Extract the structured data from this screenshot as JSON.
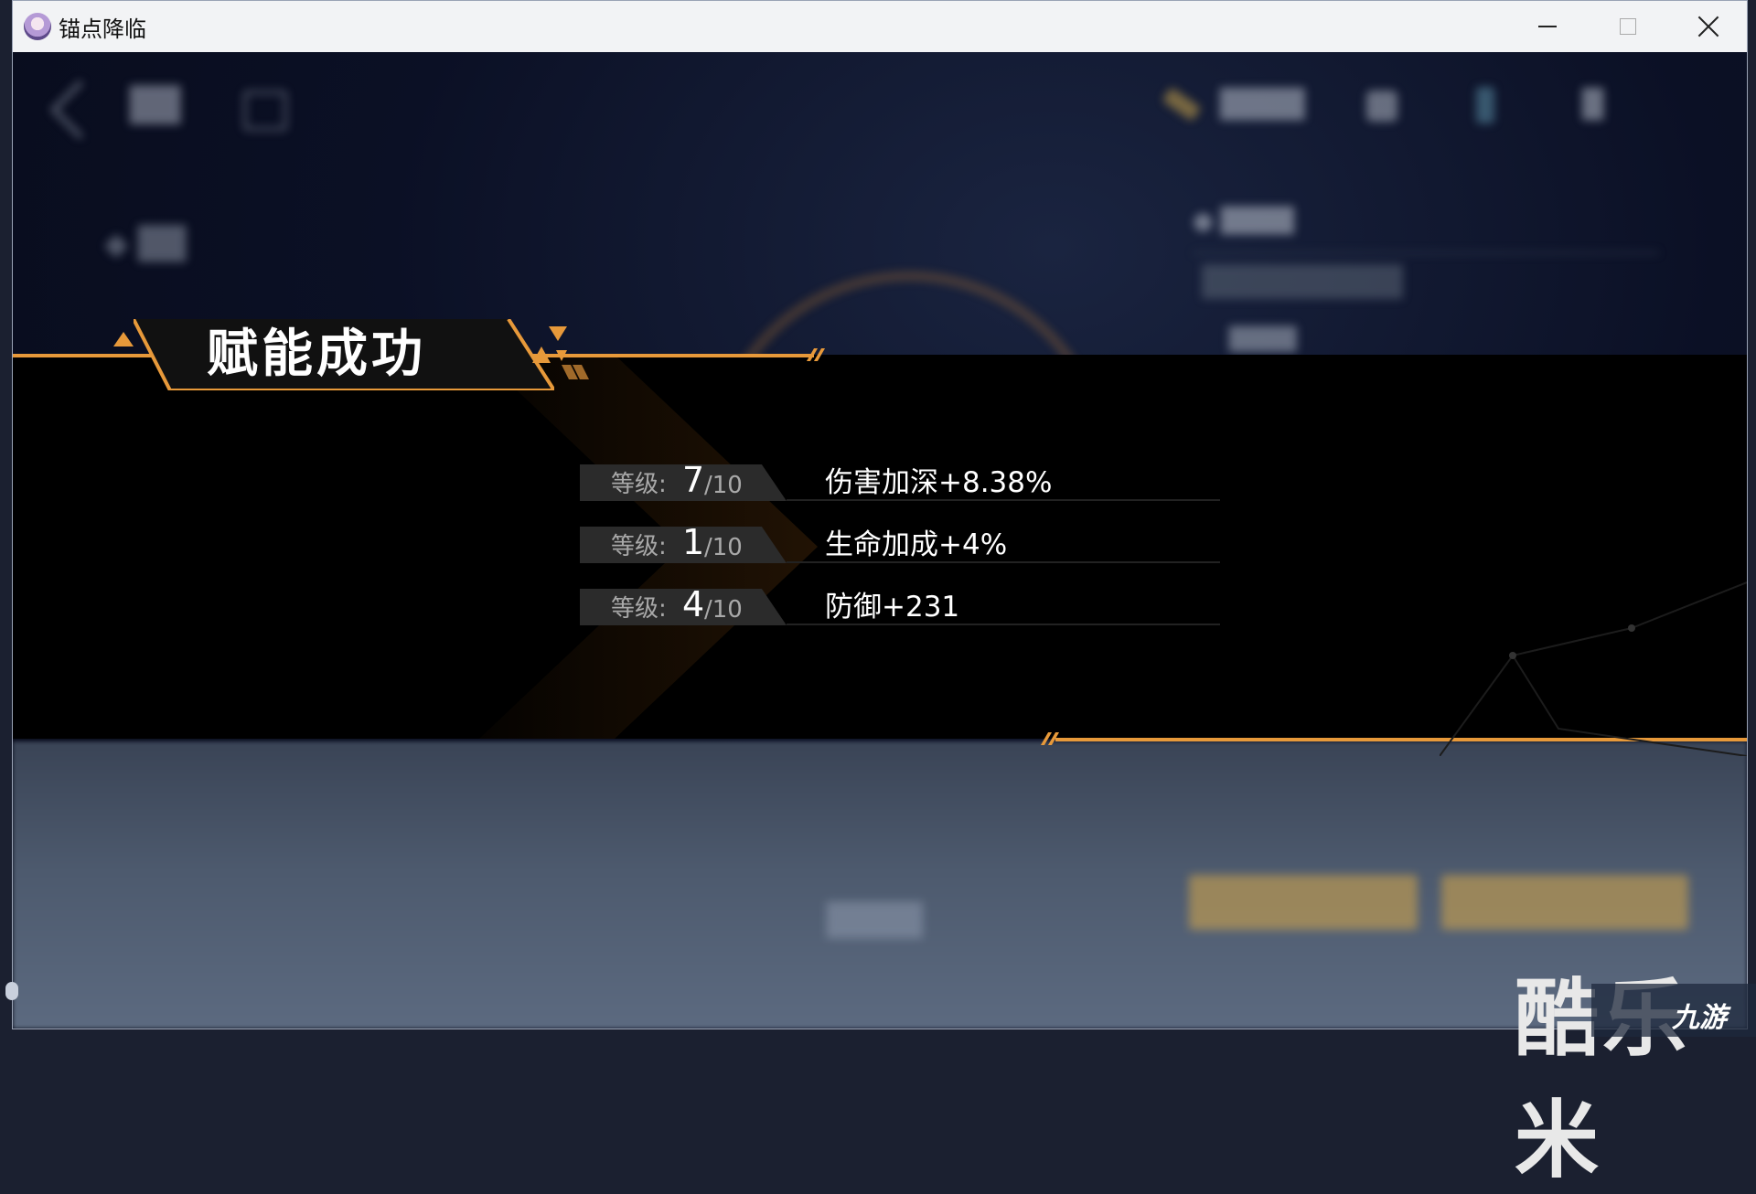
{
  "window": {
    "title": "锚点降临",
    "controls": {
      "minimize_icon": "minimize-icon",
      "maximize_icon": "maximize-icon",
      "close_icon": "close-icon"
    }
  },
  "banner": {
    "title": "赋能成功",
    "accent_color": "#e7993a",
    "results": [
      {
        "level_label": "等级:",
        "level_current": "7",
        "level_max": "/10",
        "effect": "伤害加深+8.38%"
      },
      {
        "level_label": "等级:",
        "level_current": "1",
        "level_max": "/10",
        "effect": "生命加成+4%"
      },
      {
        "level_label": "等级:",
        "level_current": "4",
        "level_max": "/10",
        "effect": "防御+231"
      }
    ]
  },
  "watermark": {
    "text": "酷乐米",
    "logo_text": "九游"
  }
}
